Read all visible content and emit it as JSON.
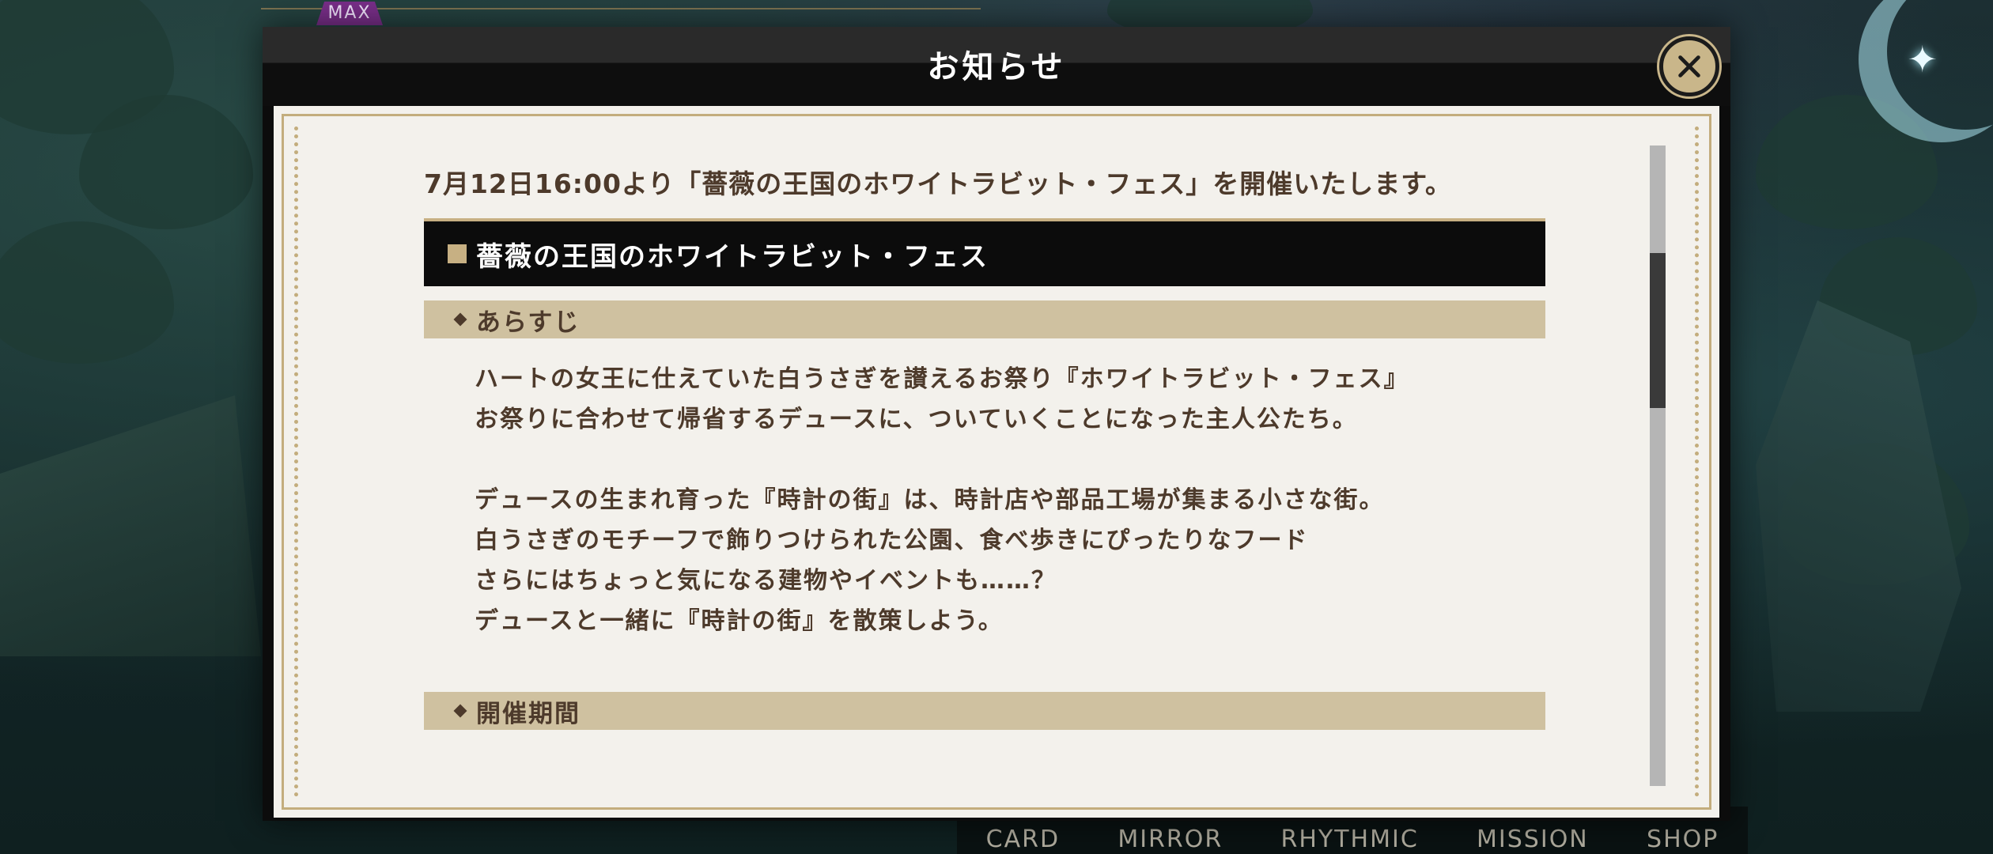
{
  "hud": {
    "max_badge": "MAX"
  },
  "bottom_nav": [
    "CARD",
    "MIRROR",
    "RHYTHMIC",
    "MISSION",
    "SHOP"
  ],
  "dialog": {
    "title": "お知らせ",
    "close_icon": "close-icon",
    "intro": "7月12日16:00より「薔薇の王国のホワイトラビット・フェス」を開催いたします。",
    "section_title": "薔薇の王国のホワイトラビット・フェス",
    "synopsis_label": "あらすじ",
    "synopsis_lines": [
      "ハートの女王に仕えていた白うさぎを讃えるお祭り『ホワイトラビット・フェス』",
      "お祭りに合わせて帰省するデュースに、ついていくことになった主人公たち。",
      "",
      "デュースの生まれ育った『時計の街』は、時計店や部品工場が集まる小さな街。",
      "白うさぎのモチーフで飾りつけられた公園、食べ歩きにぴったりなフード",
      "さらにはちょっと気になる建物やイベントも……？",
      "デュースと一緒に『時計の街』を散策しよう。"
    ],
    "period_label": "開催期間"
  },
  "colors": {
    "accent_gold": "#c7b083",
    "subheader_tan": "#cfc1a0",
    "text_brown": "#4d3a2b",
    "paper": "#f3f1ec"
  }
}
